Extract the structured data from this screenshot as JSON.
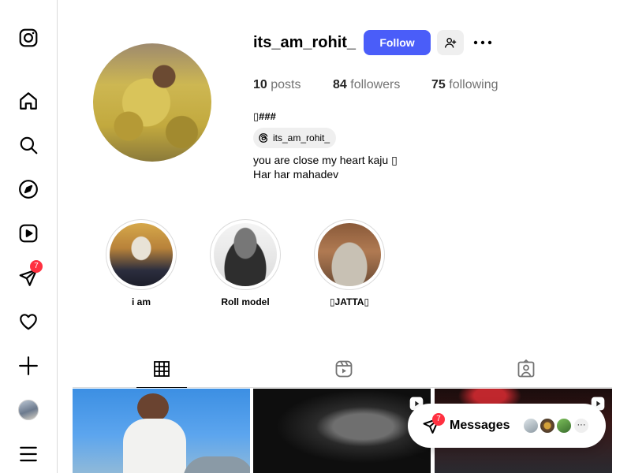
{
  "sidebar": {
    "items": [
      {
        "name": "instagram-logo-icon"
      },
      {
        "name": "home-icon"
      },
      {
        "name": "search-icon"
      },
      {
        "name": "explore-icon"
      },
      {
        "name": "reels-icon"
      },
      {
        "name": "messages-icon",
        "badge": "7"
      },
      {
        "name": "notifications-icon"
      },
      {
        "name": "create-icon"
      },
      {
        "name": "profile-avatar"
      },
      {
        "name": "menu-icon"
      }
    ]
  },
  "profile": {
    "username": "its_am_rohit_",
    "follow_label": "Follow",
    "stats": {
      "posts_count": "10",
      "posts_label": "posts",
      "followers_count": "84",
      "followers_label": "followers",
      "following_count": "75",
      "following_label": "following"
    },
    "bio_name": "▯###",
    "threads_handle": "its_am_rohit_",
    "bio_lines": [
      "you are close my heart kaju ▯",
      "Har har mahadev"
    ]
  },
  "highlights": [
    {
      "label": "i am"
    },
    {
      "label": "Roll model"
    },
    {
      "label": "▯JATTA▯"
    }
  ],
  "tabs": [
    {
      "name": "posts-tab",
      "icon": "grid-icon",
      "active": true
    },
    {
      "name": "reels-tab",
      "icon": "reels-icon",
      "active": false
    },
    {
      "name": "tagged-tab",
      "icon": "tagged-icon",
      "active": false
    }
  ],
  "messages": {
    "label": "Messages",
    "badge": "7",
    "more": "···"
  },
  "colors": {
    "follow_button": "#4a5df9",
    "badge": "#ff3040",
    "secondary_text": "#737373"
  }
}
